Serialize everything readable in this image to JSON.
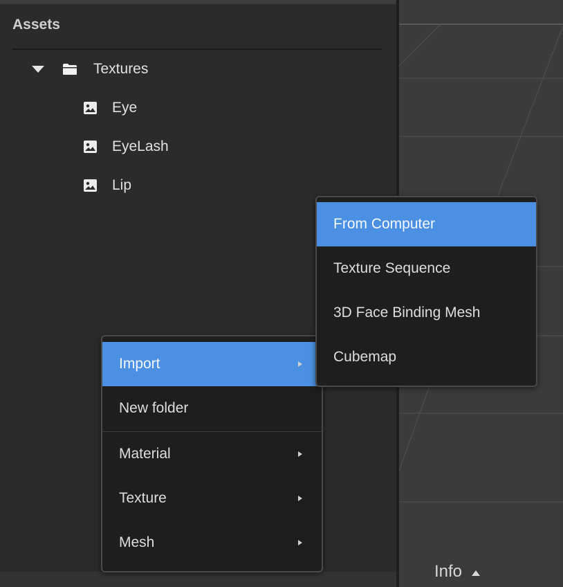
{
  "assets": {
    "title": "Assets",
    "tree": {
      "folder": {
        "label": "Textures",
        "expanded": true,
        "icon": "folder-icon"
      },
      "items": [
        {
          "label": "Eye",
          "icon": "image-icon"
        },
        {
          "label": "EyeLash",
          "icon": "image-icon"
        },
        {
          "label": "Lip",
          "icon": "image-icon"
        }
      ]
    }
  },
  "context_menu": {
    "items": [
      {
        "label": "Import",
        "has_submenu": true,
        "highlighted": true
      },
      {
        "label": "New folder",
        "has_submenu": false
      },
      {
        "label": "Material",
        "has_submenu": true
      },
      {
        "label": "Texture",
        "has_submenu": true
      },
      {
        "label": "Mesh",
        "has_submenu": true
      }
    ]
  },
  "import_submenu": {
    "items": [
      {
        "label": "From Computer",
        "highlighted": true
      },
      {
        "label": "Texture Sequence"
      },
      {
        "label": "3D Face Binding Mesh"
      },
      {
        "label": "Cubemap"
      }
    ]
  },
  "viewport": {
    "info_label": "Info"
  },
  "colors": {
    "highlight": "#4b90e2",
    "menu_bg": "#1e1e1e",
    "panel_bg": "#2b2b2b"
  }
}
